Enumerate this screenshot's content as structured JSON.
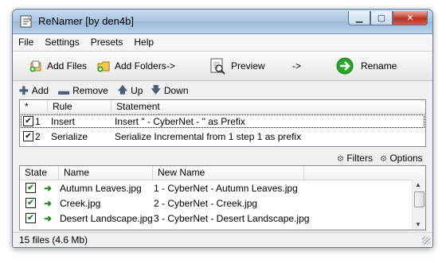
{
  "window": {
    "title": "ReNamer  [by den4b]"
  },
  "menu": [
    "File",
    "Settings",
    "Presets",
    "Help"
  ],
  "toolbar": {
    "add_files": "Add Files",
    "add_folders": "Add Folders",
    "arrow1": "->",
    "preview": "Preview",
    "arrow2": "->",
    "rename": "Rename"
  },
  "rule_toolbar": {
    "add": "Add",
    "remove": "Remove",
    "up": "Up",
    "down": "Down"
  },
  "rules_table": {
    "headers": {
      "sort": "*",
      "rule": "Rule",
      "statement": "Statement"
    },
    "rows": [
      {
        "num": "1",
        "rule": "Insert",
        "statement": "Insert \" - CyberNet - \" as Prefix",
        "checked": "✔"
      },
      {
        "num": "2",
        "rule": "Serialize",
        "statement": "Serialize Incremental from 1 step 1 as prefix",
        "checked": "✔"
      }
    ]
  },
  "file_toolbar": {
    "filters": "Filters",
    "options": "Options"
  },
  "files_table": {
    "headers": {
      "state": "State",
      "name": "Name",
      "new_name": "New Name"
    },
    "rows": [
      {
        "name": "Autumn Leaves.jpg",
        "new_name": "1 - CyberNet - Autumn Leaves.jpg",
        "checked": "✔",
        "arrow": "➜"
      },
      {
        "name": "Creek.jpg",
        "new_name": "2 - CyberNet - Creek.jpg",
        "checked": "✔",
        "arrow": "➜"
      },
      {
        "name": "Desert Landscape.jpg",
        "new_name": "3 - CyberNet - Desert Landscape.jpg",
        "checked": "✔",
        "arrow": "➜"
      }
    ]
  },
  "status": {
    "text": "15 files (4.6 Mb)"
  },
  "colors": {
    "rename_green": "#2aa52a",
    "arrow_green": "#1e8a1e"
  }
}
